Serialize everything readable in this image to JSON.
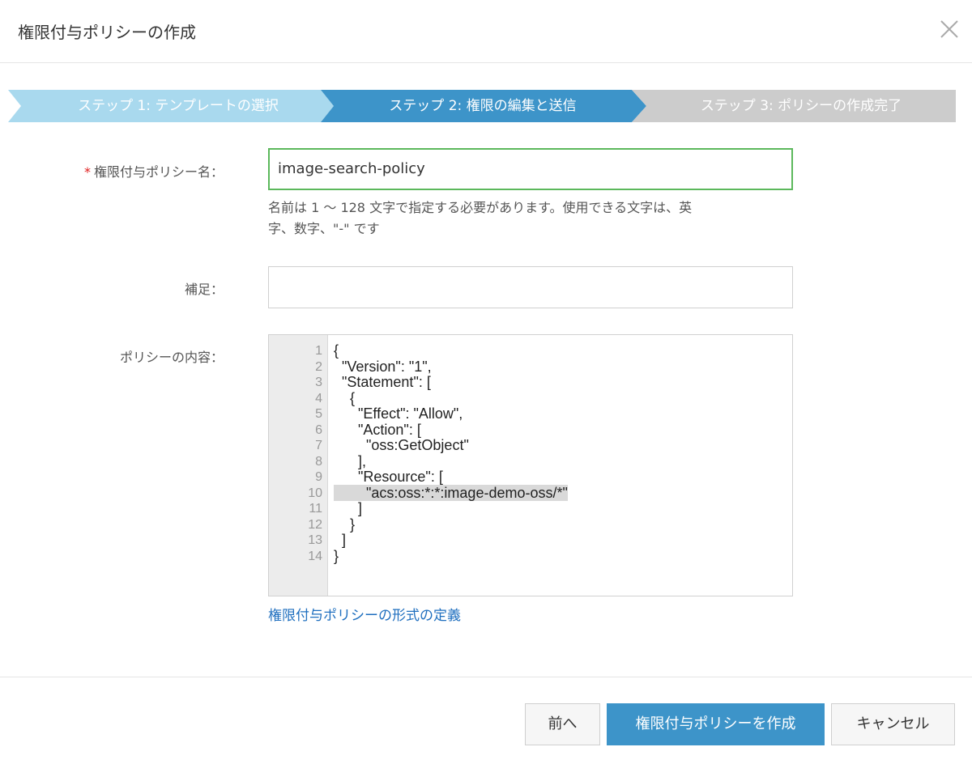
{
  "dialog": {
    "title": "権限付与ポリシーの作成"
  },
  "steps": [
    {
      "label": "ステップ 1: テンプレートの選択",
      "state": "done"
    },
    {
      "label": "ステップ 2: 権限の編集と送信",
      "state": "current"
    },
    {
      "label": "ステップ 3: ポリシーの作成完了",
      "state": "pending"
    }
  ],
  "form": {
    "name_label": "権限付与ポリシー名：",
    "required_mark": "*",
    "name_value": "image-search-policy",
    "name_help_1": "名前は 1 〜 128 文字で指定する必要があります。使用できる文字は、英",
    "name_help_2": "字、数字、\"-\" です",
    "note_label": "補足：",
    "note_value": "",
    "policy_label": "ポリシーの内容：",
    "policy_lines": [
      "{",
      "  \"Version\": \"1\",",
      "  \"Statement\": [",
      "    {",
      "      \"Effect\": \"Allow\",",
      "      \"Action\": [",
      "        \"oss:GetObject\"",
      "      ],",
      "      \"Resource\": [",
      "        \"acs:oss:*:*:image-demo-oss/*\"",
      "      ]",
      "    }",
      "  ]",
      "}"
    ],
    "line_numbers": [
      "1",
      "2",
      "3",
      "4",
      "5",
      "6",
      "7",
      "8",
      "9",
      "10",
      "11",
      "12",
      "13",
      "14"
    ],
    "highlighted_line": 10,
    "format_link": "権限付与ポリシーの形式の定義"
  },
  "buttons": {
    "back": "前へ",
    "create": "権限付与ポリシーを作成",
    "cancel": "キャンセル"
  },
  "colors": {
    "step_done": "#a9d9ee",
    "step_current": "#3d94c9",
    "step_pending": "#cccccc",
    "focus_border": "#5cb85c",
    "link": "#1f6fbf",
    "primary": "#3d94c9"
  },
  "icons": {
    "close": "close-icon"
  }
}
